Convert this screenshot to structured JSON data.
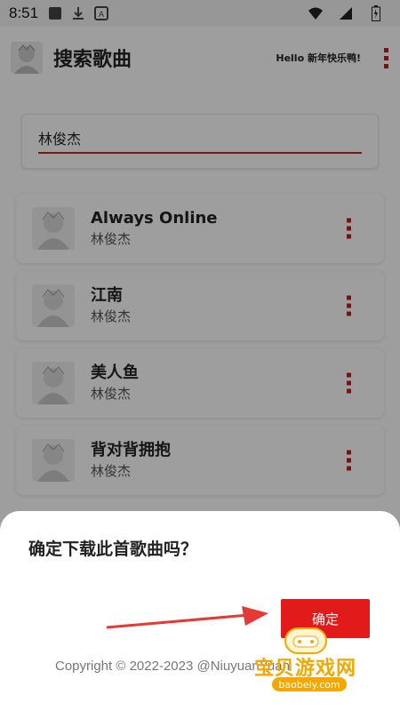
{
  "status_bar": {
    "time": "8:51",
    "left_icons": [
      "square-icon",
      "download-icon",
      "a-badge-icon"
    ],
    "right_icons": [
      "wifi-icon",
      "signal-icon",
      "battery-icon"
    ]
  },
  "app_bar": {
    "title": "搜索歌曲",
    "hello": "Hello 新年快乐鸭!"
  },
  "search": {
    "value": "林俊杰",
    "placeholder": ""
  },
  "songs": [
    {
      "title": "Always Online",
      "artist": "林俊杰"
    },
    {
      "title": "江南",
      "artist": "林俊杰"
    },
    {
      "title": "美人鱼",
      "artist": "林俊杰"
    },
    {
      "title": "背对背拥抱",
      "artist": "林俊杰"
    }
  ],
  "dialog": {
    "title": "确定下载此首歌曲吗？",
    "confirm_label": "确定",
    "copyright": "Copyright © 2022-2023 @NiuyuanYuan"
  },
  "watermark": {
    "brand": "宝贝游戏网",
    "url": "baobeiy.com"
  },
  "colors": {
    "accent": "#e31a1a",
    "kebab": "#b22222",
    "scrim": "rgba(0,0,0,0.38)",
    "watermark": "#f2a800"
  }
}
